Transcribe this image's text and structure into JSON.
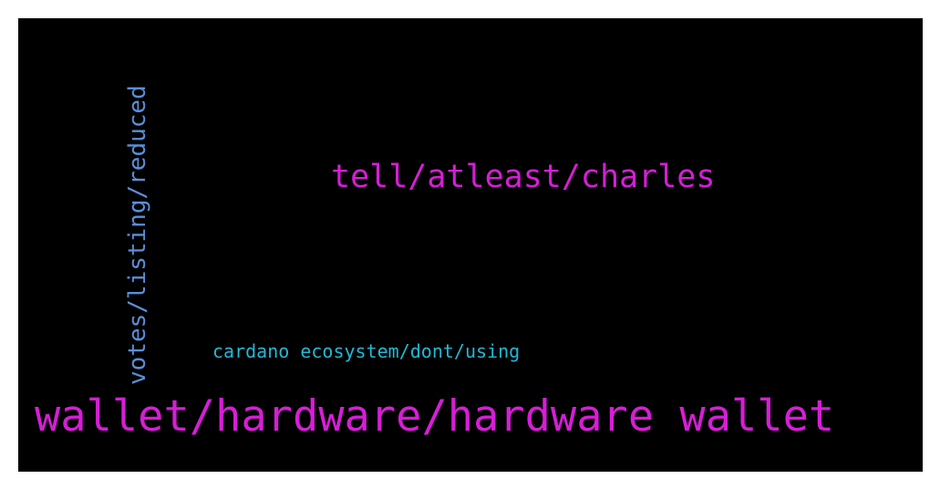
{
  "background_color": "#000000",
  "words": {
    "wallet": {
      "text": "wallet/hardware/hardware wallet",
      "color": "#d61ed6"
    },
    "tell": {
      "text": "tell/atleast/charles",
      "color": "#d61ed6"
    },
    "cardano": {
      "text": "cardano ecosystem/dont/using",
      "color": "#22b8d6"
    },
    "votes": {
      "text": "votes/listing/reduced",
      "color": "#5a8fd6",
      "orientation": "vertical"
    }
  }
}
